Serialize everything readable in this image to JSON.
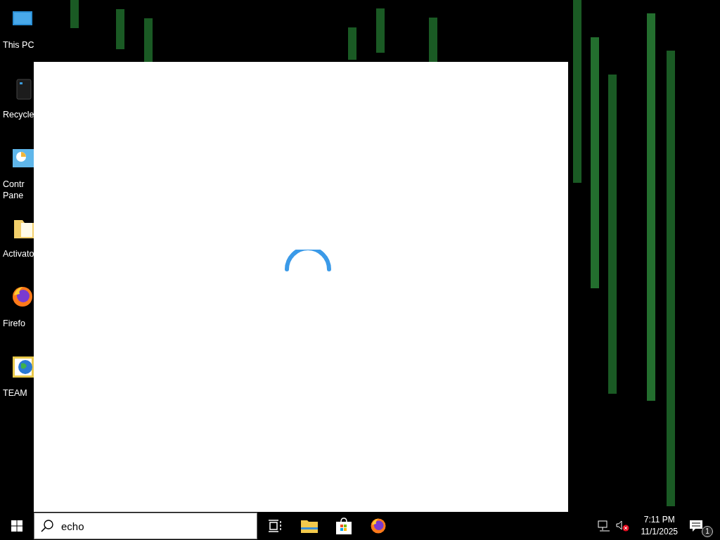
{
  "desktop_icons": [
    {
      "kind": "pc",
      "label": [
        "This PC"
      ]
    },
    {
      "kind": "bin",
      "label": [
        "Recycle"
      ]
    },
    {
      "kind": "control",
      "label": [
        "Contr",
        "Pane"
      ]
    },
    {
      "kind": "folder",
      "label": [
        "Activato"
      ]
    },
    {
      "kind": "firefox",
      "label": [
        "Firefo"
      ]
    },
    {
      "kind": "globe",
      "label": [
        "TEAM"
      ]
    }
  ],
  "search_panel": {
    "loading": true
  },
  "taskbar": {
    "search": {
      "value": "echo "
    },
    "apps": [
      {
        "kind": "taskview"
      },
      {
        "kind": "explorer"
      },
      {
        "kind": "store"
      },
      {
        "kind": "firefox"
      }
    ],
    "time": "7:11 PM",
    "date": "11/1/2025",
    "notifications": "1"
  }
}
